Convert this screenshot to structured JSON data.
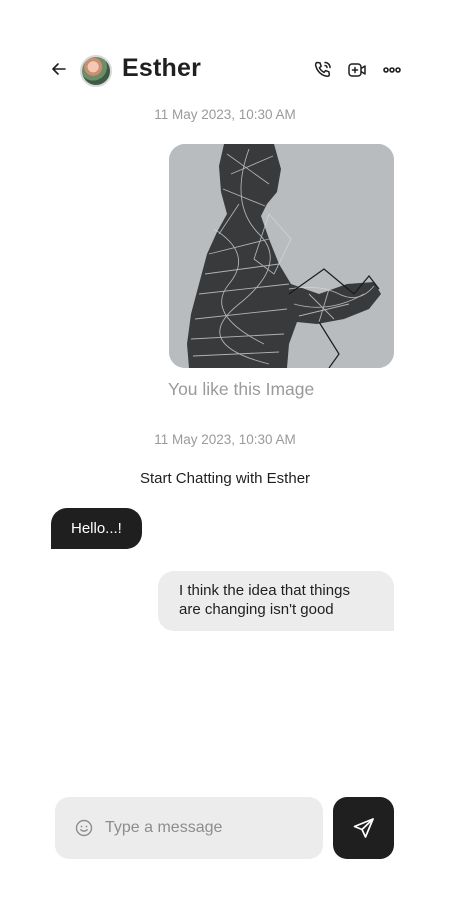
{
  "header": {
    "contact_name": "Esther",
    "back_icon": "arrow-left-icon",
    "call_icon": "phone-call-icon",
    "video_icon": "video-call-icon",
    "more_icon": "more-dots-icon"
  },
  "timeline": {
    "timestamp_1": "11 May 2023, 10:30 AM",
    "image_caption": "You like this Image",
    "timestamp_2": "11 May 2023, 10:30 AM",
    "start_chatting": "Start Chatting with Esther"
  },
  "messages": {
    "received_1": "Hello...!",
    "sent_1_line1": "I think the idea that things",
    "sent_1_line2": "are changing isn't good"
  },
  "composer": {
    "placeholder": "Type a message",
    "emoji_icon": "emoji-smile-icon",
    "send_icon": "send-icon"
  },
  "colors": {
    "dark_bubble": "#1f1f1f",
    "light_bubble": "#ececec",
    "muted_text": "#9a9a9a",
    "image_background": "#b8bcbe"
  }
}
